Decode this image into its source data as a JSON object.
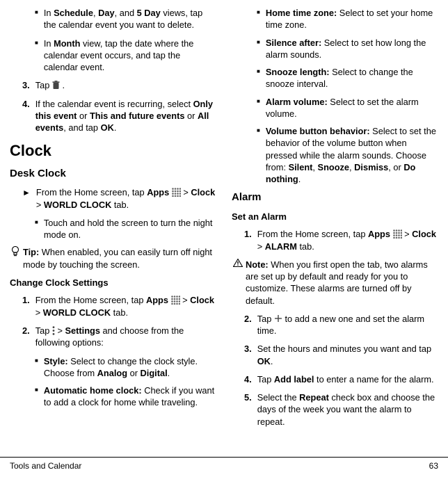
{
  "footer": {
    "left": "Tools and Calendar",
    "right": "63"
  },
  "left": {
    "b1": "In <b>Schedule</b>, <b>Day</b>, and <b>5 Day</b> views, tap the calendar event you want to delete.",
    "b2": "In <b>Month</b> view, tap the date where the calendar event occurs, and tap the calendar event.",
    "s3_a": "Tap ",
    "s3_b": " .",
    "s4": "If the calendar event is recurring, select <b>Only this event</b> or <b>This and future events</b> or <b>All events</b>, and tap <b>OK</b>.",
    "h1_clock": "Clock",
    "h2_desk": "Desk Clock",
    "desk1_a": "From the Home screen, tap <b>Apps</b> ",
    "desk1_b": " > <b>Clock</b> > <b>WORLD CLOCK</b> tab.",
    "desk_sub": "Touch and hold the screen to turn the night mode on.",
    "tip": "<b>Tip:</b> When enabled, you can easily turn off night mode by touching the screen.",
    "h3_ccs": "Change Clock Settings",
    "ccs1_a": "From the Home screen, tap <b>Apps</b> ",
    "ccs1_b": " > <b>Clock</b> > <b>WORLD CLOCK</b> tab.",
    "ccs2_a": "Tap ",
    "ccs2_b": " > <b>Settings</b> and choose from the following options:",
    "opt_style": "<b>Style:</b> Select to change the clock style. Choose from <b>Analog</b> or <b>Digital</b>.",
    "opt_auto": "<b>Automatic home clock:</b> Check if you want to add a clock for home while traveling."
  },
  "right": {
    "opt_home": "<b>Home time zone:</b> Select to set your home time zone.",
    "opt_silence": "<b>Silence after:</b> Select to set how long the alarm sounds.",
    "opt_snooze": "<b>Snooze length:</b> Select to change the snooze interval.",
    "opt_volume": "<b>Alarm volume:</b> Select to set the alarm volume.",
    "opt_vbb": "<b>Volume button behavior:</b> Select to set the behavior of the volume button when pressed while the alarm sounds. Choose from: <b>Silent</b>, <b>Snooze</b>, <b>Dismiss</b>, or <b>Do nothing</b>.",
    "h2_alarm": "Alarm",
    "h3_set": "Set an Alarm",
    "a1_a": "From the Home screen, tap <b>Apps</b> ",
    "a1_b": " > <b>Clock</b> > <b>ALARM</b> tab.",
    "note": "<b>Note:</b> When you first open the tab, two alarms are set up by default and ready for you to customize. These alarms are turned off by default.",
    "a2_a": "Tap ",
    "a2_b": " to add a new one and set the alarm time.",
    "a3": "Set the hours and minutes you want and tap <b>OK</b>.",
    "a4": "Tap <b>Add label</b> to enter a name for the alarm.",
    "a5": "Select the <b>Repeat</b> check box and choose the days of the week you want the alarm to repeat."
  }
}
